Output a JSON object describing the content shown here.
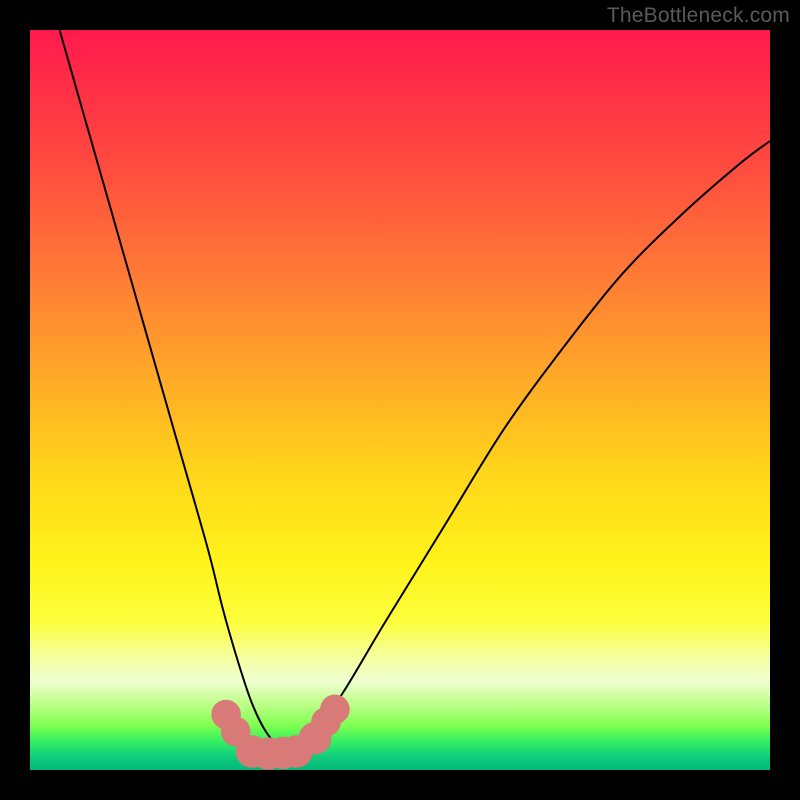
{
  "watermark": "TheBottleneck.com",
  "chart_data": {
    "type": "line",
    "title": "",
    "xlabel": "",
    "ylabel": "",
    "xlim": [
      0,
      100
    ],
    "ylim": [
      0,
      100
    ],
    "grid": false,
    "legend": false,
    "series": [
      {
        "name": "curve",
        "color": "#000000",
        "x": [
          4,
          8,
          12,
          16,
          20,
          24,
          26,
          28,
          30,
          32,
          34,
          36,
          38,
          42,
          48,
          56,
          64,
          72,
          80,
          88,
          96,
          100
        ],
        "y": [
          100,
          86,
          72,
          58,
          44,
          30,
          22,
          15,
          9,
          5,
          3,
          3,
          5,
          10,
          20,
          33,
          46,
          57,
          67,
          75,
          82,
          85
        ]
      }
    ],
    "markers": [
      {
        "name": "marker",
        "color": "#d87a78",
        "x": 26.5,
        "y": 7.5,
        "r": 2.0
      },
      {
        "name": "marker",
        "color": "#d87a78",
        "x": 27.8,
        "y": 5.2,
        "r": 2.0
      },
      {
        "name": "marker",
        "color": "#d87a78",
        "x": 30.0,
        "y": 2.5,
        "r": 2.2
      },
      {
        "name": "marker",
        "color": "#d87a78",
        "x": 32.2,
        "y": 2.2,
        "r": 2.2
      },
      {
        "name": "marker",
        "color": "#d87a78",
        "x": 34.2,
        "y": 2.3,
        "r": 2.2
      },
      {
        "name": "marker",
        "color": "#d87a78",
        "x": 36.0,
        "y": 2.5,
        "r": 2.2
      },
      {
        "name": "marker",
        "color": "#d87a78",
        "x": 38.5,
        "y": 4.3,
        "r": 2.2
      },
      {
        "name": "marker",
        "color": "#d87a78",
        "x": 40.0,
        "y": 6.5,
        "r": 2.0
      },
      {
        "name": "marker",
        "color": "#d87a78",
        "x": 41.2,
        "y": 8.2,
        "r": 2.0
      }
    ],
    "background_gradient": {
      "direction": "vertical",
      "stops": [
        {
          "pos": 0,
          "color": "#ff1a4d"
        },
        {
          "pos": 50,
          "color": "#ffc31f"
        },
        {
          "pos": 80,
          "color": "#fdff3d"
        },
        {
          "pos": 100,
          "color": "#00b87a"
        }
      ]
    }
  }
}
